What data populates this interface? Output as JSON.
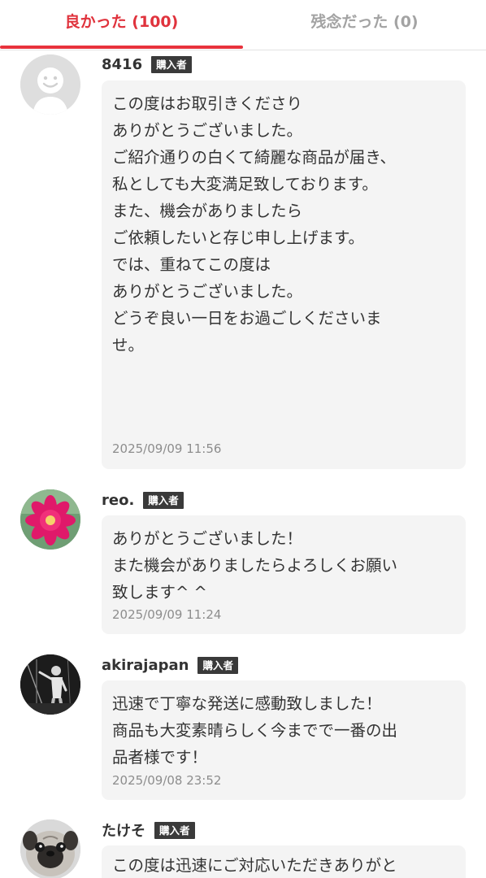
{
  "tabs": {
    "good_label": "良かった (100)",
    "bad_label": "残念だった (0)",
    "active": "good",
    "accent_color": "#e8323c"
  },
  "badge_label": "購入者",
  "reviews": [
    {
      "user": "8416",
      "badge": "購入者",
      "avatar": "default-person-icon",
      "lines": [
        "この度はお取引きくださり",
        "ありがとうございました。",
        "ご紹介通りの白くて綺麗な商品が届き、",
        "私としても大変満足致しております。",
        "また、機会がありましたら",
        "ご依頼したいと存じ申し上げます。",
        "では、重ねてこの度は",
        "ありがとうございました。",
        "どうぞ良い一日をお過ごしくださいま",
        "せ。"
      ],
      "date": "2025/09/09 11:56"
    },
    {
      "user": "reo.",
      "badge": "購入者",
      "avatar": "pink-flower-photo",
      "lines": [
        "ありがとうございました！",
        "また機会がありましたらよろしくお願い",
        "致します^ ^"
      ],
      "date": "2025/09/09 11:24"
    },
    {
      "user": "akirajapan",
      "badge": "購入者",
      "avatar": "performer-photo",
      "lines": [
        "迅速で丁寧な発送に感動致しました！",
        "商品も大変素晴らしく今までで一番の出",
        "品者様です！"
      ],
      "date": "2025/09/08 23:52"
    },
    {
      "user": "たけそ",
      "badge": "購入者",
      "avatar": "pug-dog-photo",
      "lines": [
        "この度は迅速にご対応いただきありがと"
      ],
      "date": ""
    }
  ]
}
